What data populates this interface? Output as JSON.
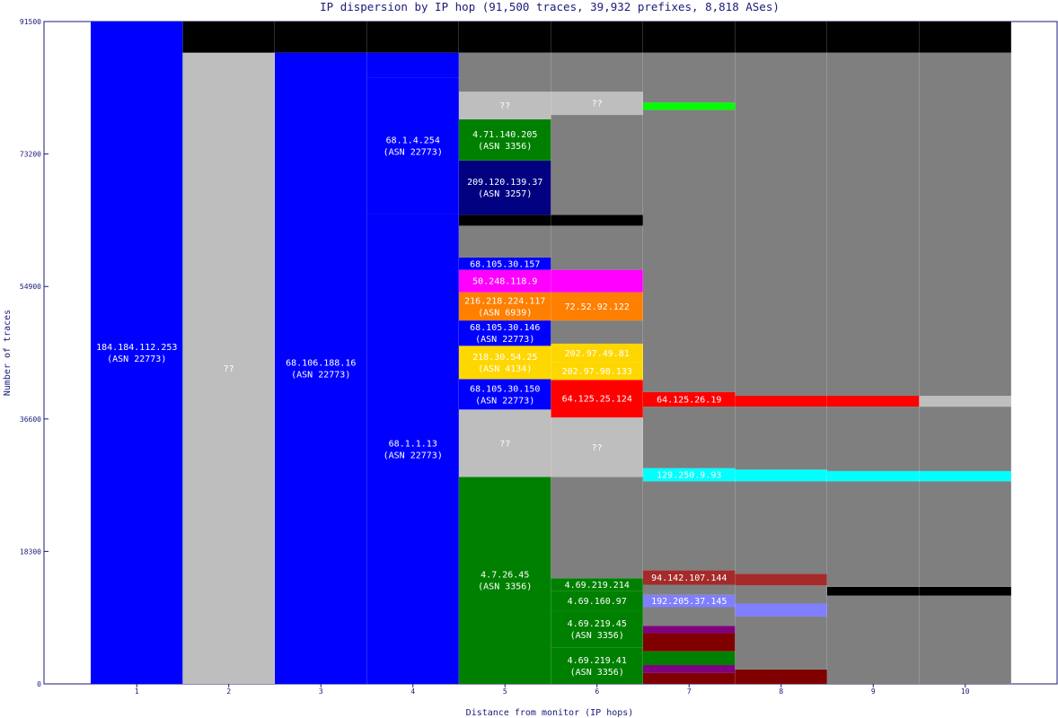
{
  "chart_data": {
    "type": "bar",
    "title": "IP dispersion by IP hop (91,500 traces, 39,932 prefixes, 8,818 ASes)",
    "xlabel": "Distance from monitor (IP hops)",
    "ylabel": "Number of traces",
    "ylim": [
      0,
      91500
    ],
    "yticks": [
      "0",
      "18300",
      "36600",
      "54900",
      "73200",
      "91500"
    ],
    "categories": [
      "1",
      "2",
      "3",
      "4",
      "5",
      "6",
      "7",
      "8",
      "9",
      "10"
    ],
    "grid": false,
    "legend": "none",
    "hops": [
      {
        "hop": "1",
        "segments": [
          {
            "y0": 0,
            "y1": 91500,
            "color": "#0000ff",
            "label": "184.184.112.253",
            "asn": "(ASN 22773)"
          }
        ]
      },
      {
        "hop": "2",
        "segments": [
          {
            "y0": 0,
            "y1": 87200,
            "color": "#bebebe",
            "label": "??"
          },
          {
            "y0": 87200,
            "y1": 91500,
            "color": "#000000"
          }
        ]
      },
      {
        "hop": "3",
        "segments": [
          {
            "y0": 0,
            "y1": 87200,
            "color": "#0000ff",
            "label": "68.106.188.16",
            "asn": "(ASN 22773)"
          },
          {
            "y0": 87200,
            "y1": 91500,
            "color": "#000000"
          }
        ]
      },
      {
        "hop": "4",
        "segments": [
          {
            "y0": 0,
            "y1": 64900,
            "color": "#0000ff",
            "label": "68.1.1.13",
            "asn": "(ASN 22773)"
          },
          {
            "y0": 64900,
            "y1": 83700,
            "color": "#0000ff",
            "label": "68.1.4.254",
            "asn": "(ASN 22773)"
          },
          {
            "y0": 83700,
            "y1": 87200,
            "color": "#0000ff"
          },
          {
            "y0": 87200,
            "y1": 91500,
            "color": "#000000"
          }
        ]
      },
      {
        "hop": "5",
        "segments": [
          {
            "y0": 0,
            "y1": 28600,
            "color": "#008000",
            "label": "4.7.26.45",
            "asn": "(ASN 3356)"
          },
          {
            "y0": 28600,
            "y1": 37900,
            "color": "#bebebe",
            "label": "??"
          },
          {
            "y0": 37900,
            "y1": 42100,
            "color": "#0000ff",
            "label": "68.105.30.150",
            "asn": "(ASN 22773)"
          },
          {
            "y0": 42100,
            "y1": 46700,
            "color": "#ffd700",
            "label": "218.30.54.25",
            "asn": "(ASN 4134)"
          },
          {
            "y0": 46700,
            "y1": 50200,
            "color": "#0000ff",
            "label": "68.105.30.146",
            "asn": "(ASN 22773)"
          },
          {
            "y0": 50200,
            "y1": 54100,
            "color": "#ff7f00",
            "label": "216.218.224.117",
            "asn": "(ASN 6939)"
          },
          {
            "y0": 54100,
            "y1": 57200,
            "color": "#ff00ff",
            "label": "50.248.118.9"
          },
          {
            "y0": 57200,
            "y1": 58900,
            "color": "#0000ff",
            "label": "68.105.30.157"
          },
          {
            "y0": 58900,
            "y1": 63300,
            "color": "#7f7f7f"
          },
          {
            "y0": 63300,
            "y1": 64800,
            "color": "#000000"
          },
          {
            "y0": 64800,
            "y1": 72300,
            "color": "#000080",
            "label": "209.120.139.37",
            "asn": "(ASN 3257)"
          },
          {
            "y0": 72300,
            "y1": 78000,
            "color": "#008000",
            "label": "4.71.140.205",
            "asn": "(ASN 3356)"
          },
          {
            "y0": 78000,
            "y1": 81800,
            "color": "#bebebe",
            "label": "??"
          },
          {
            "y0": 81800,
            "y1": 87200,
            "color": "#7f7f7f"
          },
          {
            "y0": 87200,
            "y1": 91500,
            "color": "#000000"
          }
        ]
      },
      {
        "hop": "6",
        "segments": [
          {
            "y0": 0,
            "y1": 5000,
            "color": "#008000",
            "label": "4.69.219.41",
            "asn": "(ASN 3356)"
          },
          {
            "y0": 5000,
            "y1": 10100,
            "color": "#008000",
            "label": "4.69.219.45",
            "asn": "(ASN 3356)"
          },
          {
            "y0": 10100,
            "y1": 12800,
            "color": "#008000",
            "label": "4.69.160.97"
          },
          {
            "y0": 12800,
            "y1": 14600,
            "color": "#008000",
            "label": "4.69.219.214"
          },
          {
            "y0": 14600,
            "y1": 28600,
            "color": "#7f7f7f"
          },
          {
            "y0": 28600,
            "y1": 36800,
            "color": "#bebebe",
            "label": "??"
          },
          {
            "y0": 36800,
            "y1": 42000,
            "color": "#ff0000",
            "label": "64.125.25.124"
          },
          {
            "y0": 42000,
            "y1": 44400,
            "color": "#ffd700",
            "label": "202.97.90.133"
          },
          {
            "y0": 44400,
            "y1": 47000,
            "color": "#ffd700",
            "label": "202.97.49.81"
          },
          {
            "y0": 47000,
            "y1": 50200,
            "color": "#7f7f7f"
          },
          {
            "y0": 50200,
            "y1": 54100,
            "color": "#ff7f00",
            "label": "72.52.92.122"
          },
          {
            "y0": 54100,
            "y1": 57200,
            "color": "#ff00ff"
          },
          {
            "y0": 57200,
            "y1": 63300,
            "color": "#7f7f7f"
          },
          {
            "y0": 63300,
            "y1": 64800,
            "color": "#000000"
          },
          {
            "y0": 64800,
            "y1": 78600,
            "color": "#7f7f7f"
          },
          {
            "y0": 78600,
            "y1": 81800,
            "color": "#bebebe",
            "label": "??"
          },
          {
            "y0": 81800,
            "y1": 87200,
            "color": "#7f7f7f"
          },
          {
            "y0": 87200,
            "y1": 91500,
            "color": "#000000"
          }
        ]
      },
      {
        "hop": "7",
        "segments": [
          {
            "y0": 0,
            "y1": 1500,
            "color": "#800000"
          },
          {
            "y0": 1500,
            "y1": 2600,
            "color": "#800080"
          },
          {
            "y0": 2600,
            "y1": 4500,
            "color": "#008000"
          },
          {
            "y0": 4500,
            "y1": 7000,
            "color": "#800000"
          },
          {
            "y0": 7000,
            "y1": 8000,
            "color": "#800080"
          },
          {
            "y0": 8000,
            "y1": 10600,
            "color": "#7f7f7f"
          },
          {
            "y0": 10600,
            "y1": 12300,
            "color": "#7f7fff",
            "label": "192.205.37.145"
          },
          {
            "y0": 12300,
            "y1": 13700,
            "color": "#7f7f7f"
          },
          {
            "y0": 13700,
            "y1": 15700,
            "color": "#a52a2a",
            "label": "94.142.107.144"
          },
          {
            "y0": 15700,
            "y1": 28000,
            "color": "#7f7f7f"
          },
          {
            "y0": 28000,
            "y1": 29800,
            "color": "#00ffff",
            "label": "129.250.9.93"
          },
          {
            "y0": 29800,
            "y1": 38300,
            "color": "#7f7f7f"
          },
          {
            "y0": 38300,
            "y1": 40300,
            "color": "#ff0000",
            "label": "64.125.26.19"
          },
          {
            "y0": 40300,
            "y1": 79300,
            "color": "#7f7f7f"
          },
          {
            "y0": 79300,
            "y1": 80300,
            "color": "#00ff00"
          },
          {
            "y0": 80300,
            "y1": 87200,
            "color": "#7f7f7f"
          },
          {
            "y0": 87200,
            "y1": 91500,
            "color": "#000000"
          }
        ]
      },
      {
        "hop": "8",
        "segments": [
          {
            "y0": 0,
            "y1": 2000,
            "color": "#800000"
          },
          {
            "y0": 2000,
            "y1": 9300,
            "color": "#7f7f7f"
          },
          {
            "y0": 9300,
            "y1": 11100,
            "color": "#7f7fff"
          },
          {
            "y0": 11100,
            "y1": 13600,
            "color": "#7f7f7f"
          },
          {
            "y0": 13600,
            "y1": 15200,
            "color": "#a52a2a"
          },
          {
            "y0": 15200,
            "y1": 28000,
            "color": "#7f7f7f"
          },
          {
            "y0": 28000,
            "y1": 29600,
            "color": "#00ffff"
          },
          {
            "y0": 29600,
            "y1": 38300,
            "color": "#7f7f7f"
          },
          {
            "y0": 38300,
            "y1": 39800,
            "color": "#ff0000"
          },
          {
            "y0": 39800,
            "y1": 87200,
            "color": "#7f7f7f"
          },
          {
            "y0": 87200,
            "y1": 91500,
            "color": "#000000"
          }
        ]
      },
      {
        "hop": "9",
        "segments": [
          {
            "y0": 0,
            "y1": 12200,
            "color": "#7f7f7f"
          },
          {
            "y0": 12200,
            "y1": 13400,
            "color": "#000000"
          },
          {
            "y0": 13400,
            "y1": 28000,
            "color": "#7f7f7f"
          },
          {
            "y0": 28000,
            "y1": 29400,
            "color": "#00ffff"
          },
          {
            "y0": 29400,
            "y1": 38300,
            "color": "#7f7f7f"
          },
          {
            "y0": 38300,
            "y1": 39800,
            "color": "#ff0000"
          },
          {
            "y0": 39800,
            "y1": 87200,
            "color": "#7f7f7f"
          },
          {
            "y0": 87200,
            "y1": 91500,
            "color": "#000000"
          }
        ]
      },
      {
        "hop": "10",
        "segments": [
          {
            "y0": 0,
            "y1": 12200,
            "color": "#7f7f7f"
          },
          {
            "y0": 12200,
            "y1": 13400,
            "color": "#000000"
          },
          {
            "y0": 13400,
            "y1": 28000,
            "color": "#7f7f7f"
          },
          {
            "y0": 28000,
            "y1": 29400,
            "color": "#00ffff"
          },
          {
            "y0": 29400,
            "y1": 38300,
            "color": "#7f7f7f"
          },
          {
            "y0": 38300,
            "y1": 39800,
            "color": "#bebebe"
          },
          {
            "y0": 39800,
            "y1": 87200,
            "color": "#7f7f7f"
          },
          {
            "y0": 87200,
            "y1": 91500,
            "color": "#000000"
          }
        ]
      }
    ]
  },
  "colors": {
    "text": "#1a1a7a",
    "frame": "#1a1a7a",
    "plot_bg": "#ffffff"
  }
}
